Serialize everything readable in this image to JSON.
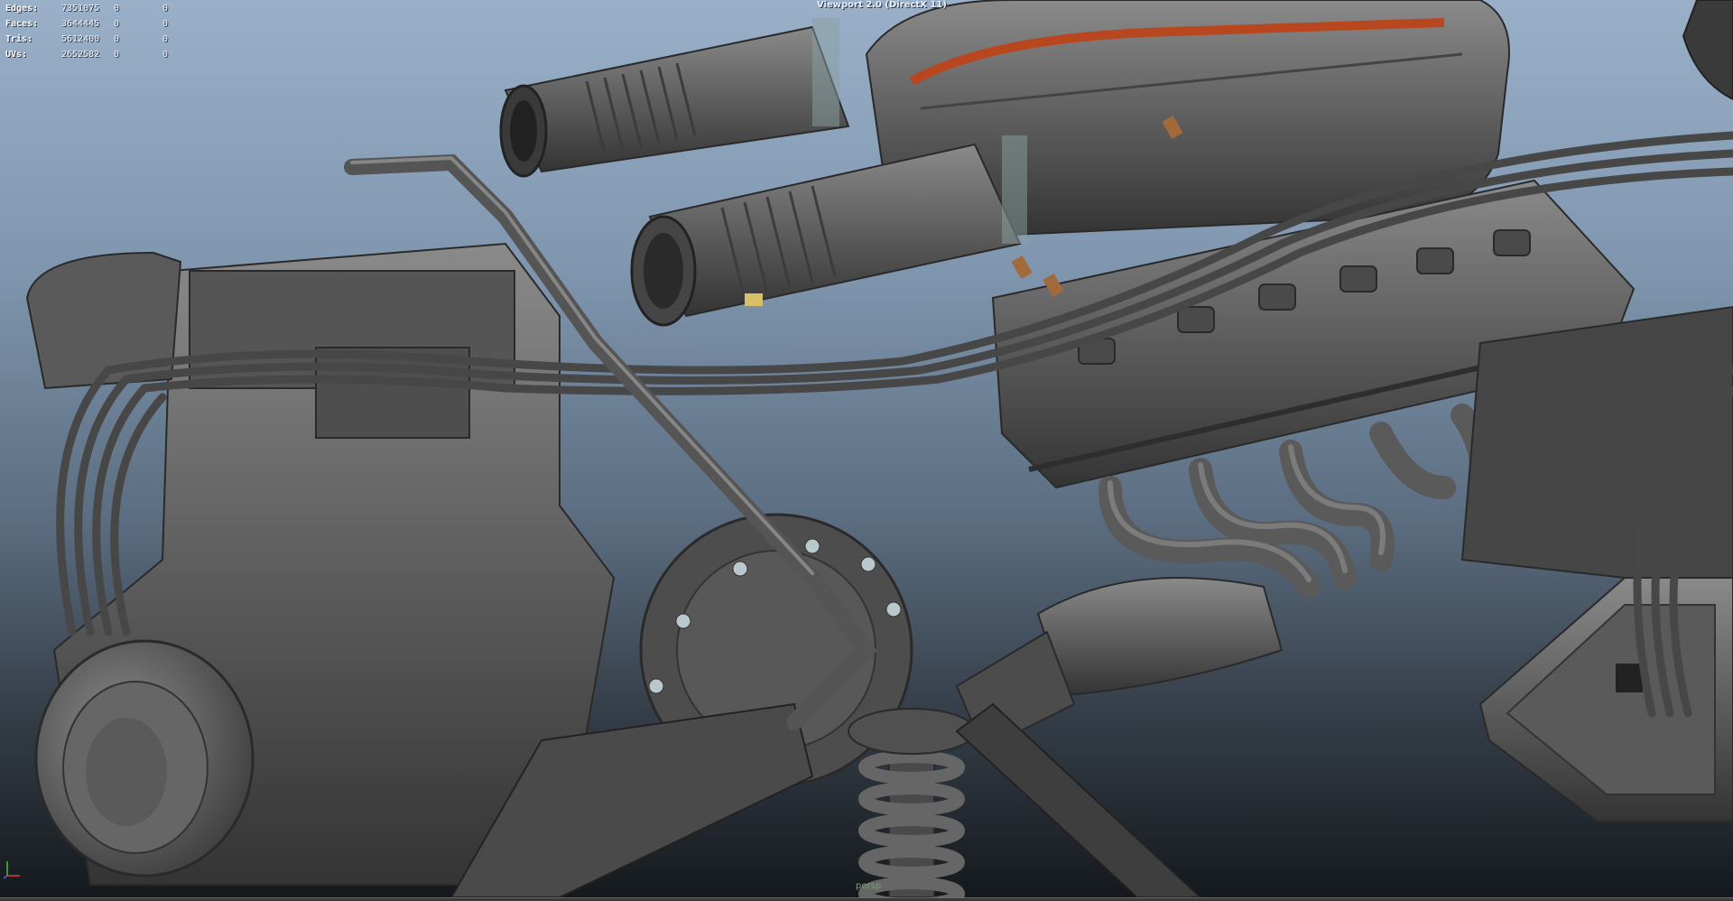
{
  "viewport": {
    "title": "Viewport 2.0 (DirectX 11)",
    "camera": "persp"
  },
  "hud": {
    "rows": [
      {
        "label": "Edges:",
        "value": "7351075",
        "sel1": "0",
        "sel2": "0"
      },
      {
        "label": "Faces:",
        "value": "3644445",
        "sel1": "0",
        "sel2": "0"
      },
      {
        "label": "Tris:",
        "value": "5612400",
        "sel1": "0",
        "sel2": "0"
      },
      {
        "label": "UVs:",
        "value": "2652582",
        "sel1": "0",
        "sel2": "0"
      }
    ]
  },
  "colors": {
    "background_top": "#9ab0c9",
    "background_bottom": "#15191d",
    "model_grey": "#5d5d5d",
    "accent_orange": "#c85a3a",
    "hud_text": "#ffffff"
  }
}
